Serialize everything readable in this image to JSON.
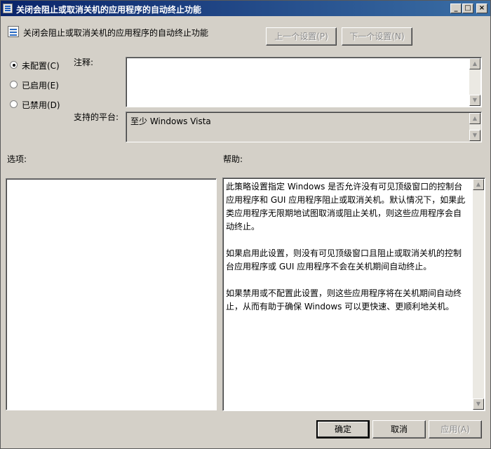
{
  "window": {
    "title": "关闭会阻止或取消关机的应用程序的自动终止功能",
    "controls": {
      "minimize": "_",
      "maximize": "□",
      "close": "×"
    }
  },
  "policy": {
    "name": "关闭会阻止或取消关机的应用程序的自动终止功能",
    "icon": "policy-setting-icon"
  },
  "nav": {
    "prev_label": "上一个设置(P)",
    "next_label": "下一个设置(N)"
  },
  "state": {
    "options": [
      {
        "label": "未配置(C)",
        "selected": true
      },
      {
        "label": "已启用(E)",
        "selected": false
      },
      {
        "label": "已禁用(D)",
        "selected": false
      }
    ]
  },
  "comment": {
    "label": "注释:",
    "value": ""
  },
  "platform": {
    "label": "支持的平台:",
    "value": "至少 Windows Vista"
  },
  "options_section": {
    "label": "选项:"
  },
  "help": {
    "label": "帮助:",
    "paragraphs": [
      "此策略设置指定 Windows 是否允许没有可见顶级窗口的控制台应用程序和 GUI 应用程序阻止或取消关机。默认情况下，如果此类应用程序无限期地试图取消或阻止关机，则这些应用程序会自动终止。",
      "如果启用此设置，则没有可见顶级窗口且阻止或取消关机的控制台应用程序或 GUI 应用程序不会在关机期间自动终止。",
      "如果禁用或不配置此设置，则这些应用程序将在关机期间自动终止，从而有助于确保 Windows 可以更快速、更顺利地关机。"
    ]
  },
  "footer": {
    "ok_label": "确定",
    "cancel_label": "取消",
    "apply_label": "应用(A)"
  }
}
